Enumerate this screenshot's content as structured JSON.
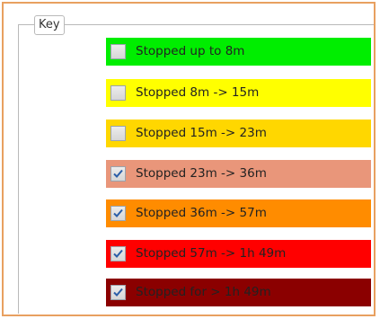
{
  "key": {
    "title": "Key",
    "items": [
      {
        "label": "Stopped up to 8m",
        "checked": false,
        "color": "#00ee00"
      },
      {
        "label": "Stopped 8m -> 15m",
        "checked": false,
        "color": "#ffff00"
      },
      {
        "label": "Stopped 15m -> 23m",
        "checked": false,
        "color": "#ffd700"
      },
      {
        "label": "Stopped 23m -> 36m",
        "checked": true,
        "color": "#e9967a"
      },
      {
        "label": "Stopped 36m -> 57m",
        "checked": true,
        "color": "#ff8c00"
      },
      {
        "label": "Stopped 57m -> 1h 49m",
        "checked": true,
        "color": "#ff0000"
      },
      {
        "label": "Stopped for > 1h 49m",
        "checked": true,
        "color": "#8b0000"
      }
    ]
  },
  "colors": {
    "panel_border": "#e8a060",
    "group_border": "#b9b9b9",
    "check_mark": "#2a5ea8"
  }
}
